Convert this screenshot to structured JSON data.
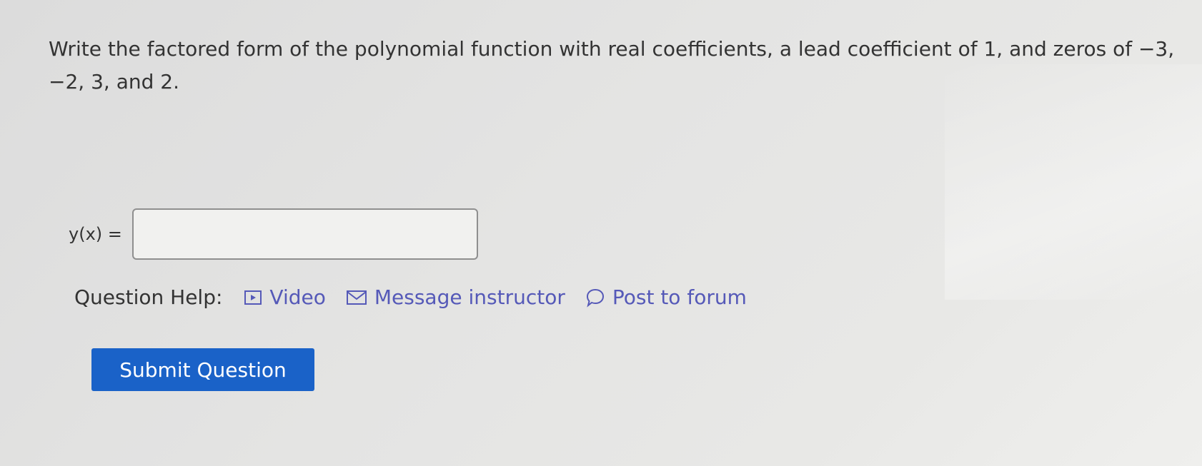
{
  "question": {
    "text": "Write the factored form of the polynomial function with real coefficients, a lead coefficient of 1, and zeros of −3, −2, 3, and 2."
  },
  "answer": {
    "label": "y(x) =",
    "value": ""
  },
  "help": {
    "label": "Question Help:",
    "video_label": "Video",
    "message_label": "Message instructor",
    "forum_label": "Post to forum",
    "link_color": "#5559b8"
  },
  "submit": {
    "label": "Submit Question",
    "color": "#1a62c8"
  }
}
